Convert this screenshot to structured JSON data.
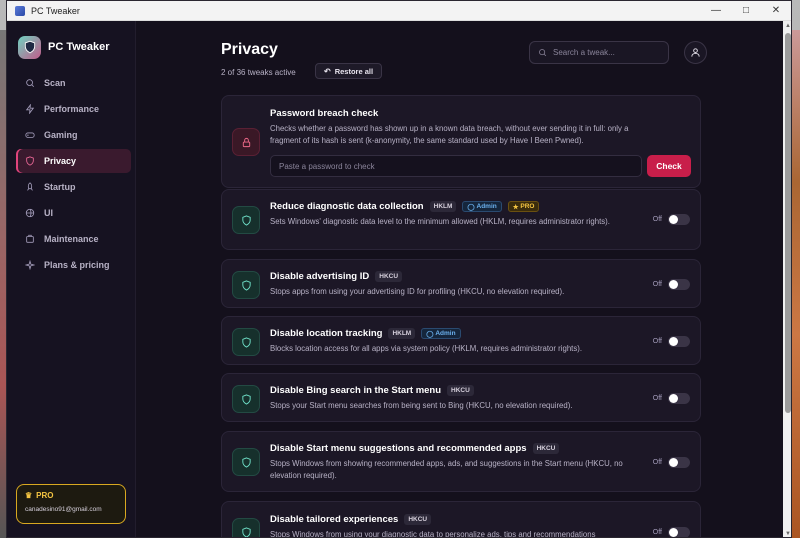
{
  "window": {
    "title": "PC Tweaker"
  },
  "sidebar": {
    "brand": "PC Tweaker",
    "items": [
      {
        "label": "Scan",
        "icon": "search-icon",
        "active": false
      },
      {
        "label": "Performance",
        "icon": "bolt-icon",
        "active": false
      },
      {
        "label": "Gaming",
        "icon": "gamepad-icon",
        "active": false
      },
      {
        "label": "Privacy",
        "icon": "shield-icon",
        "active": true
      },
      {
        "label": "Startup",
        "icon": "rocket-icon",
        "active": false
      },
      {
        "label": "UI",
        "icon": "monitor-icon",
        "active": false
      },
      {
        "label": "Maintenance",
        "icon": "wrench-icon",
        "active": false
      },
      {
        "label": "Plans & pricing",
        "icon": "sparkle-icon",
        "active": false
      }
    ],
    "pro": {
      "badge": "PRO",
      "email": "canadesino91@gmail.com"
    }
  },
  "header": {
    "title": "Privacy",
    "active_count": "2 of 36 tweaks active",
    "restore_label": "Restore all",
    "search_placeholder": "Search a tweak..."
  },
  "breach": {
    "title": "Password breach check",
    "description": "Checks whether a password has shown up in a known data breach, without ever sending it in full: only a fragment of its hash is sent (k-anonymity, the same standard used by Have I Been Pwned).",
    "placeholder": "Paste a password to check",
    "button": "Check"
  },
  "tweaks": [
    {
      "title": "Reduce diagnostic data collection",
      "tags": [
        "HKLM",
        "Admin",
        "PRO"
      ],
      "description": "Sets Windows' diagnostic data level to the minimum allowed (HKLM, requires administrator rights).",
      "state": "Off"
    },
    {
      "title": "Disable advertising ID",
      "tags": [
        "HKCU"
      ],
      "description": "Stops apps from using your advertising ID for profiling (HKCU, no elevation required).",
      "state": "Off"
    },
    {
      "title": "Disable location tracking",
      "tags": [
        "HKLM",
        "Admin"
      ],
      "description": "Blocks location access for all apps via system policy (HKLM, requires administrator rights).",
      "state": "Off"
    },
    {
      "title": "Disable Bing search in the Start menu",
      "tags": [
        "HKCU"
      ],
      "description": "Stops your Start menu searches from being sent to Bing (HKCU, no elevation required).",
      "state": "Off"
    },
    {
      "title": "Disable Start menu suggestions and recommended apps",
      "tags": [
        "HKCU"
      ],
      "description": "Stops Windows from showing recommended apps, ads, and suggestions in the Start menu (HKCU, no elevation required).",
      "state": "Off"
    },
    {
      "title": "Disable tailored experiences",
      "tags": [
        "HKCU"
      ],
      "description": "Stops Windows from using your diagnostic data to personalize ads, tips and recommendations",
      "state": "Off"
    }
  ]
}
